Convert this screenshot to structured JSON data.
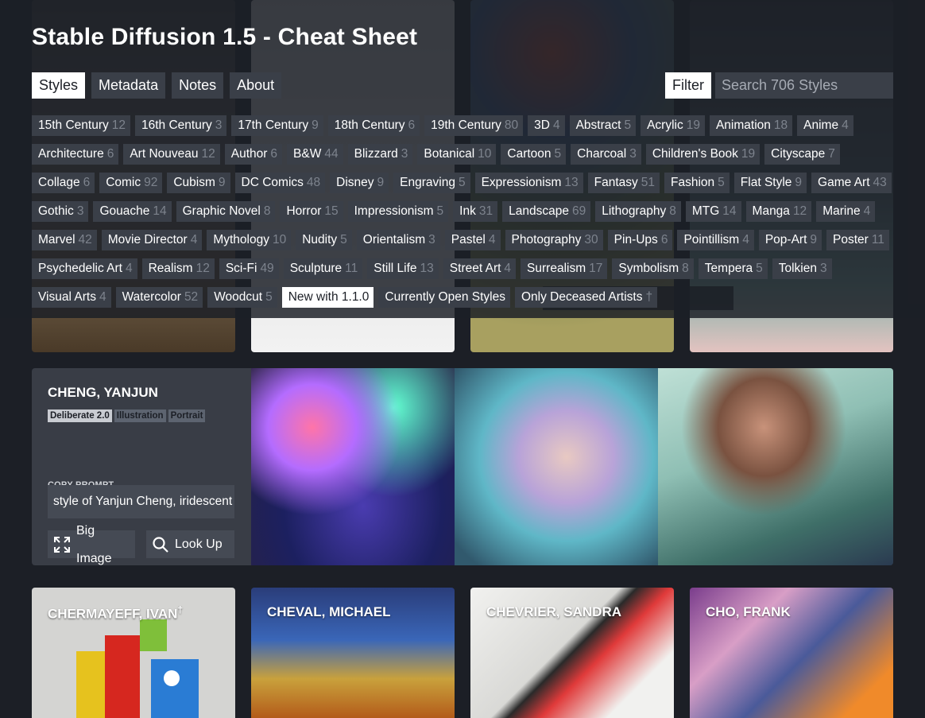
{
  "title": "Stable Diffusion 1.5 - Cheat Sheet",
  "nav": [
    {
      "label": "Styles",
      "active": true
    },
    {
      "label": "Metadata",
      "active": false
    },
    {
      "label": "Notes",
      "active": false
    },
    {
      "label": "About",
      "active": false
    }
  ],
  "filter_label": "Filter",
  "search": {
    "placeholder": "Search 706 Styles",
    "value": ""
  },
  "tags": [
    {
      "label": "15th Century",
      "count": "12"
    },
    {
      "label": "16th Century",
      "count": "3"
    },
    {
      "label": "17th Century",
      "count": "9"
    },
    {
      "label": "18th Century",
      "count": "6"
    },
    {
      "label": "19th Century",
      "count": "80"
    },
    {
      "label": "3D",
      "count": "4"
    },
    {
      "label": "Abstract",
      "count": "5"
    },
    {
      "label": "Acrylic",
      "count": "19"
    },
    {
      "label": "Animation",
      "count": "18"
    },
    {
      "label": "Anime",
      "count": "4"
    },
    {
      "label": "Architecture",
      "count": "6"
    },
    {
      "label": "Art Nouveau",
      "count": "12"
    },
    {
      "label": "Author",
      "count": "6"
    },
    {
      "label": "B&W",
      "count": "44"
    },
    {
      "label": "Blizzard",
      "count": "3"
    },
    {
      "label": "Botanical",
      "count": "10"
    },
    {
      "label": "Cartoon",
      "count": "5"
    },
    {
      "label": "Charcoal",
      "count": "3"
    },
    {
      "label": "Children's Book",
      "count": "19"
    },
    {
      "label": "Cityscape",
      "count": "7"
    },
    {
      "label": "Collage",
      "count": "6"
    },
    {
      "label": "Comic",
      "count": "92"
    },
    {
      "label": "Cubism",
      "count": "9"
    },
    {
      "label": "DC Comics",
      "count": "48"
    },
    {
      "label": "Disney",
      "count": "9"
    },
    {
      "label": "Engraving",
      "count": "5"
    },
    {
      "label": "Expressionism",
      "count": "13"
    },
    {
      "label": "Fantasy",
      "count": "51"
    },
    {
      "label": "Fashion",
      "count": "5"
    },
    {
      "label": "Flat Style",
      "count": "9"
    },
    {
      "label": "Game Art",
      "count": "43"
    },
    {
      "label": "Gothic",
      "count": "3"
    },
    {
      "label": "Gouache",
      "count": "14"
    },
    {
      "label": "Graphic Novel",
      "count": "8"
    },
    {
      "label": "Horror",
      "count": "15"
    },
    {
      "label": "Impressionism",
      "count": "5"
    },
    {
      "label": "Ink",
      "count": "31"
    },
    {
      "label": "Landscape",
      "count": "69"
    },
    {
      "label": "Lithography",
      "count": "8"
    },
    {
      "label": "MTG",
      "count": "14"
    },
    {
      "label": "Manga",
      "count": "12"
    },
    {
      "label": "Marine",
      "count": "4"
    },
    {
      "label": "Marvel",
      "count": "42"
    },
    {
      "label": "Movie Director",
      "count": "4"
    },
    {
      "label": "Mythology",
      "count": "10"
    },
    {
      "label": "Nudity",
      "count": "5"
    },
    {
      "label": "Orientalism",
      "count": "3"
    },
    {
      "label": "Pastel",
      "count": "4"
    },
    {
      "label": "Photography",
      "count": "30"
    },
    {
      "label": "Pin-Ups",
      "count": "6"
    },
    {
      "label": "Pointillism",
      "count": "4"
    },
    {
      "label": "Pop-Art",
      "count": "9"
    },
    {
      "label": "Poster",
      "count": "11"
    },
    {
      "label": "Psychedelic Art",
      "count": "4"
    },
    {
      "label": "Realism",
      "count": "12"
    },
    {
      "label": "Sci-Fi",
      "count": "49"
    },
    {
      "label": "Sculpture",
      "count": "11"
    },
    {
      "label": "Still Life",
      "count": "13"
    },
    {
      "label": "Street Art",
      "count": "4"
    },
    {
      "label": "Surrealism",
      "count": "17"
    },
    {
      "label": "Symbolism",
      "count": "8"
    },
    {
      "label": "Tempera",
      "count": "5"
    },
    {
      "label": "Tolkien",
      "count": "3"
    },
    {
      "label": "Visual Arts",
      "count": "4"
    },
    {
      "label": "Watercolor",
      "count": "52"
    },
    {
      "label": "Woodcut",
      "count": "5"
    },
    {
      "label": "New with 1.1.0",
      "count": "",
      "highlight": true
    },
    {
      "label": "Currently Open Styles",
      "count": ""
    },
    {
      "label": "Only Deceased Artists",
      "count": "†"
    }
  ],
  "featured": {
    "name": "CHENG, YANJUN",
    "badges": [
      "Deliberate 2.0",
      "Illustration",
      "Portrait"
    ],
    "copy_label": "COPY PROMPT",
    "prompt": "style of Yanjun Cheng, iridescent",
    "big_image_label": "Big Image",
    "look_up_label": "Look Up"
  },
  "cards": [
    {
      "name": "CHERMAYEFF, IVAN",
      "dagger": "†"
    },
    {
      "name": "CHEVAL, MICHAEL",
      "dagger": ""
    },
    {
      "name": "CHEVRIER, SANDRA",
      "dagger": ""
    },
    {
      "name": "CHO, FRANK",
      "dagger": ""
    }
  ],
  "colors": {
    "background": "#1c1f26",
    "tag_bg": "#3a3f48",
    "count_text": "#7d838d",
    "active": "#ffffff"
  }
}
